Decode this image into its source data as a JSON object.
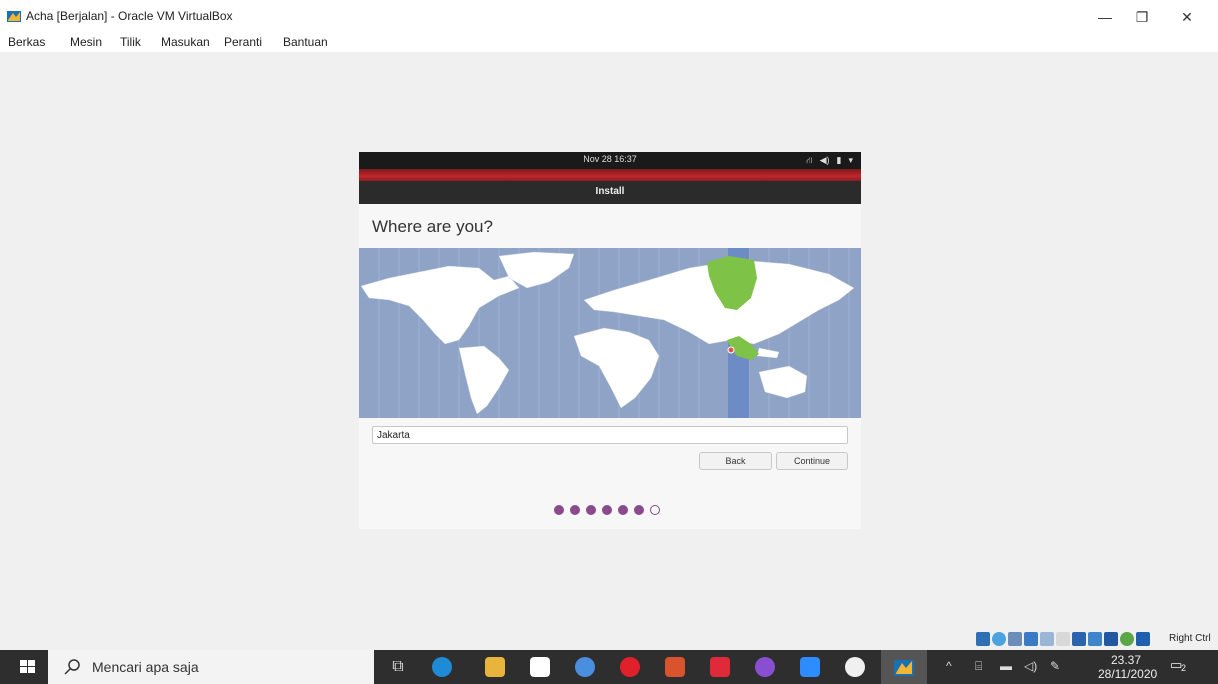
{
  "window": {
    "title": "Acha [Berjalan] - Oracle VM VirtualBox",
    "menu": [
      "Berkas",
      "Mesin",
      "Tilik",
      "Masukan",
      "Peranti",
      "Bantuan"
    ],
    "controls": {
      "minimize": "—",
      "restore": "❐",
      "close": "✕"
    }
  },
  "guest": {
    "clock": "Nov 28  16:37",
    "header_title": "Install",
    "heading": "Where are you?",
    "location_value": "Jakarta",
    "back_label": "Back",
    "continue_label": "Continue",
    "steps_total": 7,
    "steps_completed": 6,
    "selected_timezone_color": "#7fc248",
    "map_sea_color": "#8ea3c6",
    "accent_color": "#8b4a8c"
  },
  "vbox_status": {
    "host_key": "Right Ctrl"
  },
  "taskbar": {
    "search_placeholder": "Mencari apa saja",
    "time": "23.37",
    "date": "28/11/2020",
    "notification_count": "2"
  }
}
